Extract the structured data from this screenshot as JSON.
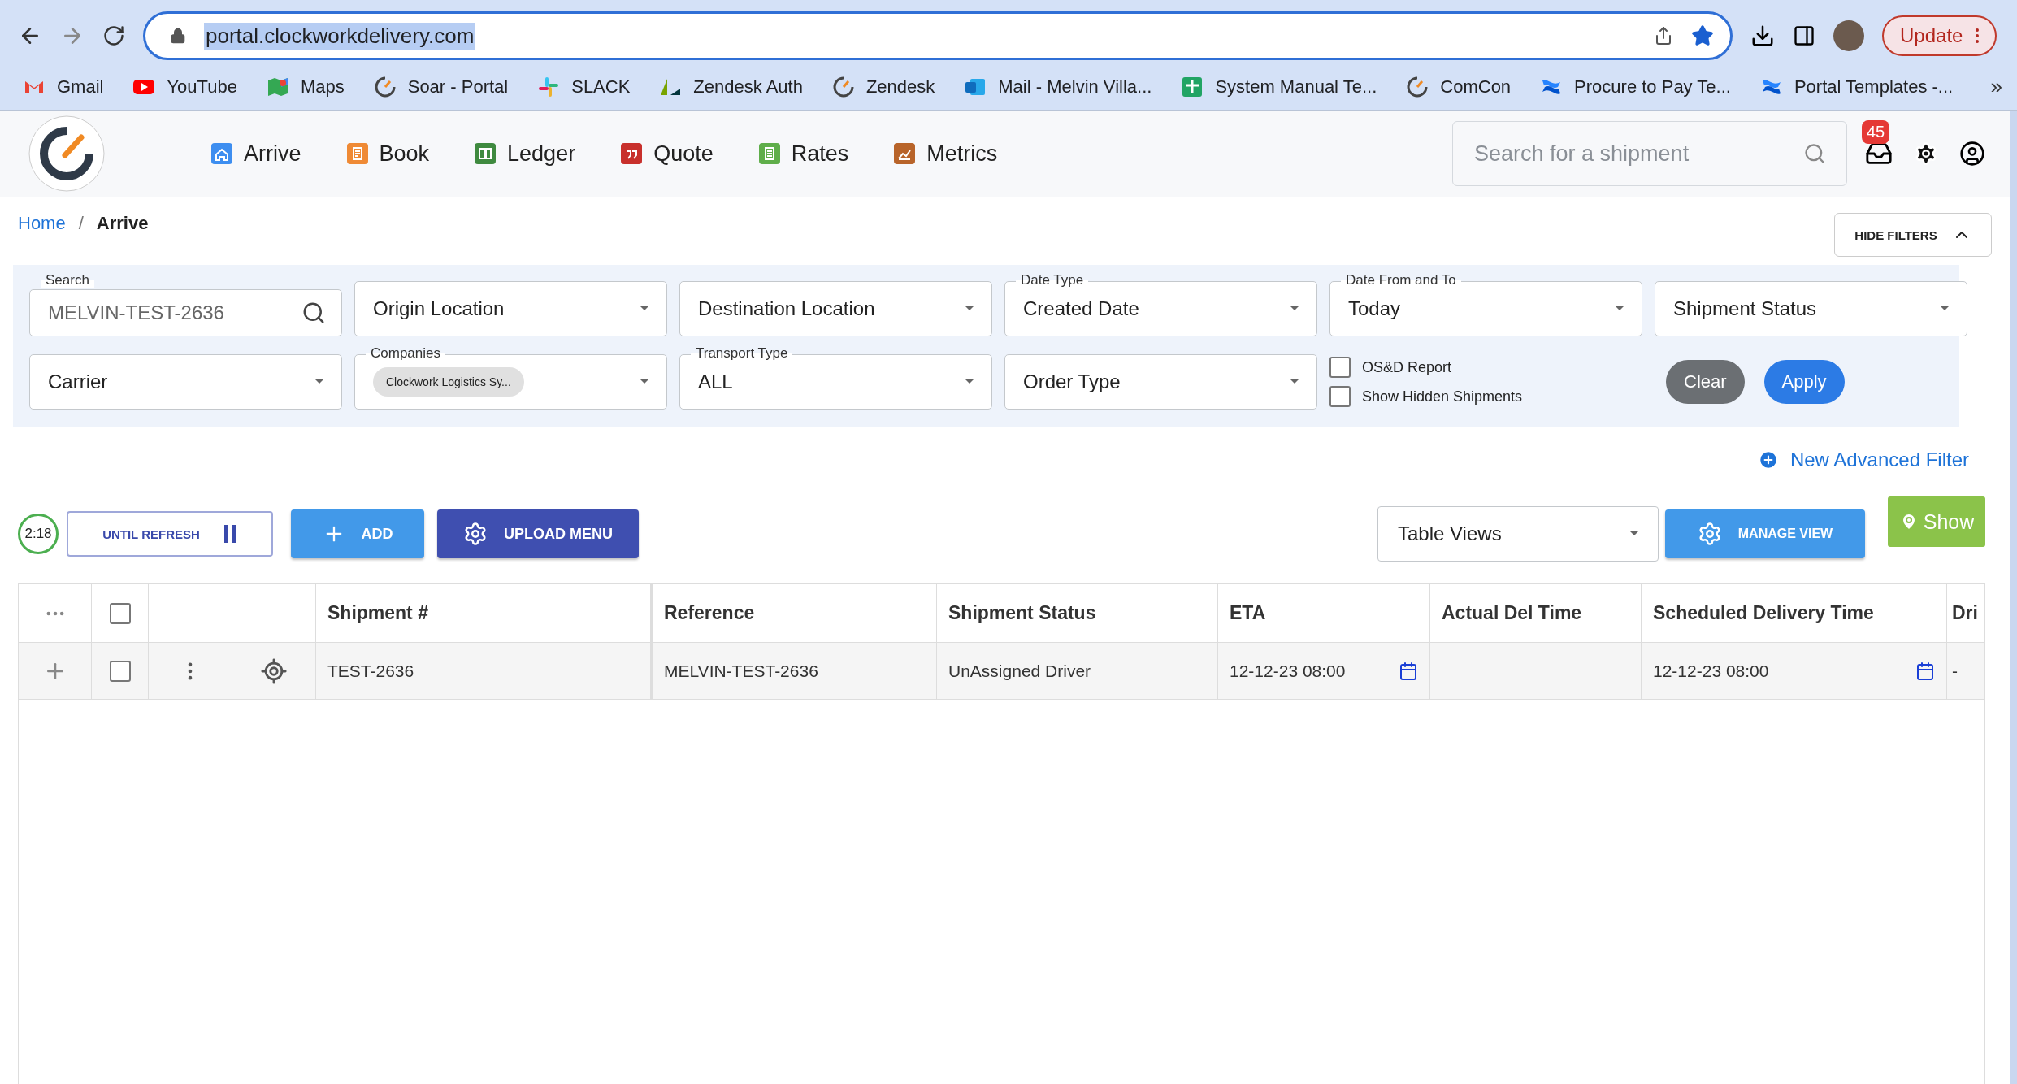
{
  "browser": {
    "url": "portal.clockworkdelivery.com",
    "update_label": "Update",
    "more_bookmarks": "»",
    "bookmarks": [
      {
        "label": "Gmail",
        "kind": "gmail"
      },
      {
        "label": "YouTube",
        "kind": "youtube"
      },
      {
        "label": "Maps",
        "kind": "maps"
      },
      {
        "label": "Soar - Portal",
        "kind": "clock"
      },
      {
        "label": "SLACK",
        "kind": "slack"
      },
      {
        "label": "Zendesk Auth",
        "kind": "zendesk"
      },
      {
        "label": "Zendesk",
        "kind": "clock"
      },
      {
        "label": "Mail - Melvin Villa...",
        "kind": "outlook"
      },
      {
        "label": "System Manual Te...",
        "kind": "sheets"
      },
      {
        "label": "ComCon",
        "kind": "clock"
      },
      {
        "label": "Procure to Pay Te...",
        "kind": "confluence"
      },
      {
        "label": "Portal Templates -...",
        "kind": "confluence"
      }
    ]
  },
  "nav": {
    "items": [
      {
        "label": "Arrive",
        "color": "#3d8ef0"
      },
      {
        "label": "Book",
        "color": "#ef8a35"
      },
      {
        "label": "Ledger",
        "color": "#3f8a3f"
      },
      {
        "label": "Quote",
        "color": "#c8302c"
      },
      {
        "label": "Rates",
        "color": "#5fae4a"
      },
      {
        "label": "Metrics",
        "color": "#b8642a"
      }
    ],
    "search": {
      "placeholder": "Search for a shipment"
    },
    "notifications": "45"
  },
  "breadcrumb": [
    "Home",
    "Arrive"
  ],
  "breadcrumb_separator": "/",
  "hide_filters": "HIDE FILTERS",
  "filters": [
    {
      "kind": "search",
      "label": "Search",
      "value": "MELVIN-TEST-2636"
    },
    {
      "kind": "select",
      "value": "Origin Location"
    },
    {
      "kind": "select",
      "value": "Destination Location"
    },
    {
      "kind": "select",
      "label": "Date Type",
      "value": "Created Date"
    },
    {
      "kind": "select",
      "label": "Date From and To",
      "value": "Today"
    },
    {
      "kind": "select",
      "value": "Shipment Status"
    },
    {
      "kind": "select",
      "value": "Carrier"
    },
    {
      "kind": "chips",
      "label": "Companies",
      "value": "Clockwork Logistics Sy..."
    },
    {
      "kind": "select",
      "label": "Transport Type",
      "value": "ALL"
    },
    {
      "kind": "select",
      "value": "Order Type"
    }
  ],
  "checkboxes": [
    {
      "label": "OS&D Report",
      "checked": false
    },
    {
      "label": "Show Hidden Shipments",
      "checked": false
    }
  ],
  "clear": "Clear",
  "apply": "Apply",
  "advanced_filter": "New Advanced Filter",
  "toolbar": {
    "timer": "2:18",
    "until_refresh": "UNTIL REFRESH",
    "add": "ADD",
    "upload": "UPLOAD MENU",
    "table_views": "Table Views",
    "manage_view": "MANAGE VIEW",
    "show": "Show"
  },
  "table": {
    "all_checked": false,
    "columns": [
      {
        "label": "Shipment #",
        "kind": "text"
      },
      {
        "label": "Reference",
        "kind": "text"
      },
      {
        "label": "Shipment Status",
        "kind": "text"
      },
      {
        "label": "ETA",
        "kind": "date"
      },
      {
        "label": "Actual Del Time",
        "kind": "text"
      },
      {
        "label": "Scheduled Delivery Time",
        "kind": "date"
      },
      {
        "label": "Dri",
        "kind": "text"
      }
    ],
    "rows": [
      {
        "checked": false,
        "cells": [
          "TEST-2636",
          "MELVIN-TEST-2636",
          "UnAssigned Driver",
          "12-12-23 08:00",
          null,
          "12-12-23 08:00",
          "-"
        ]
      }
    ]
  }
}
